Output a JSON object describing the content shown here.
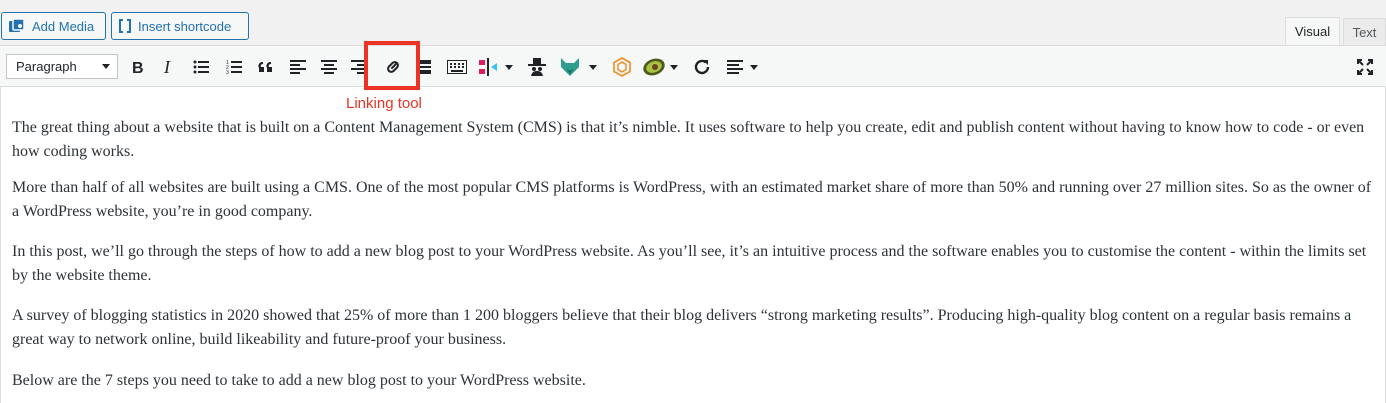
{
  "media_buttons": {
    "add_media": "Add Media",
    "insert_shortcode": "Insert shortcode"
  },
  "tabs": {
    "visual": "Visual",
    "text": "Text",
    "active": "Visual"
  },
  "toolbar": {
    "format_select": "Paragraph",
    "buttons": [
      "bold-icon",
      "italic-icon",
      "bulleted-list-icon",
      "numbered-list-icon",
      "blockquote-icon",
      "align-left-icon",
      "align-center-icon",
      "align-right-icon",
      "link-icon",
      "read-more-icon",
      "toolbar-toggle-icon",
      "plugin-split-icon",
      "plugin-spy-icon",
      "plugin-fox-icon",
      "plugin-hexagon-icon",
      "plugin-avocado-icon",
      "refresh-icon",
      "text-align-icon",
      "fullscreen-icon"
    ]
  },
  "annotation": {
    "label": "Linking tool",
    "color": "#ea3323"
  },
  "content": {
    "paragraphs": [
      "The great thing about a website that is built on a Content Management System (CMS) is that it’s nimble. It uses software to help you create, edit and publish content without having to know how to code - or even how coding works.",
      "More than half of all websites are built using a CMS. One of the most popular CMS platforms is WordPress, with an estimated market share of more than 50% and running over 27 million sites. So as the owner of a WordPress website, you’re in good company.",
      "In this post, we’ll go through the steps of how to add a new blog post to your WordPress website. As you’ll see, it’s an intuitive process and the software enables you to customise the content - within the limits set by the website theme.",
      "A survey of blogging statistics in 2020 showed that 25% of more than 1 200 bloggers believe that their blog delivers “strong marketing results”. Producing high-quality blog content on a regular basis remains a great way to network online, build likeability and future-proof your business.",
      "Below are the 7 steps you need to take to add a new blog post to your WordPress website."
    ]
  },
  "colors": {
    "accent": "#2271b1",
    "annotation": "#ea3323",
    "text": "#2c3338"
  }
}
